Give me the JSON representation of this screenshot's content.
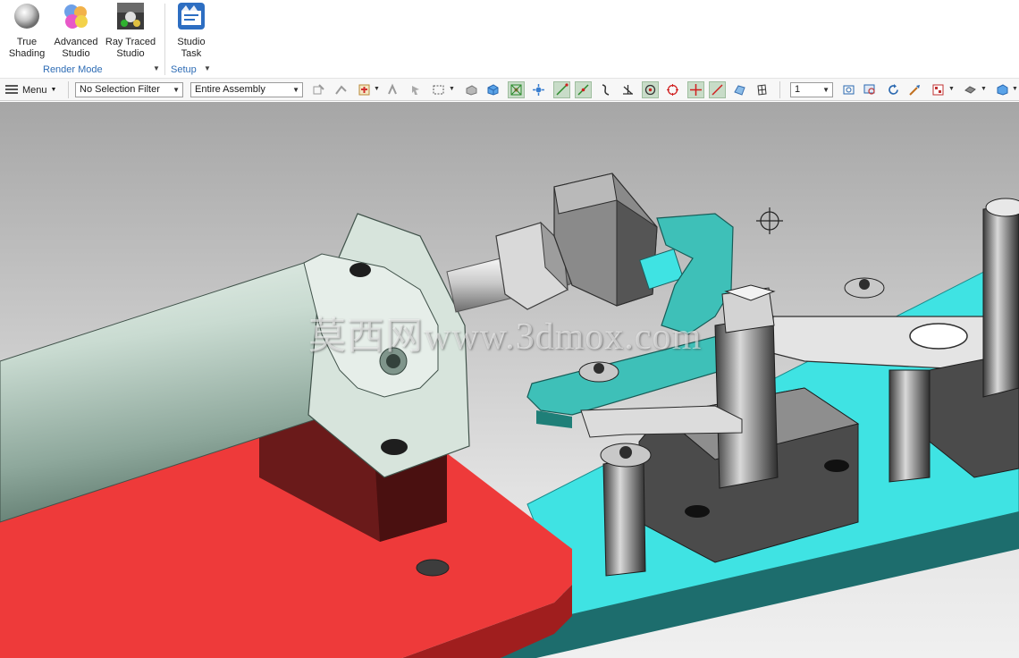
{
  "ribbon": {
    "render_mode": {
      "group_label": "Render Mode",
      "buttons": [
        {
          "label": "True\nShading",
          "icon": "true-shading-icon"
        },
        {
          "label": "Advanced\nStudio",
          "icon": "advanced-studio-icon"
        },
        {
          "label": "Ray Traced\nStudio",
          "icon": "ray-traced-studio-icon"
        }
      ]
    },
    "setup": {
      "group_label": "Setup",
      "buttons": [
        {
          "label": "Studio\nTask",
          "icon": "studio-task-icon"
        }
      ]
    }
  },
  "toolbar": {
    "menu_label": "Menu",
    "selection_filter": "No Selection Filter",
    "scope": "Entire Assembly",
    "layer_value": "1"
  },
  "viewport": {
    "watermark": "莫西网www.3dmox.com",
    "colors": {
      "base_plate": "#ee3a3a",
      "rail": "#3fe3e3",
      "cylinder": "#c4d6cc",
      "arm": "#3ec0b8"
    }
  }
}
